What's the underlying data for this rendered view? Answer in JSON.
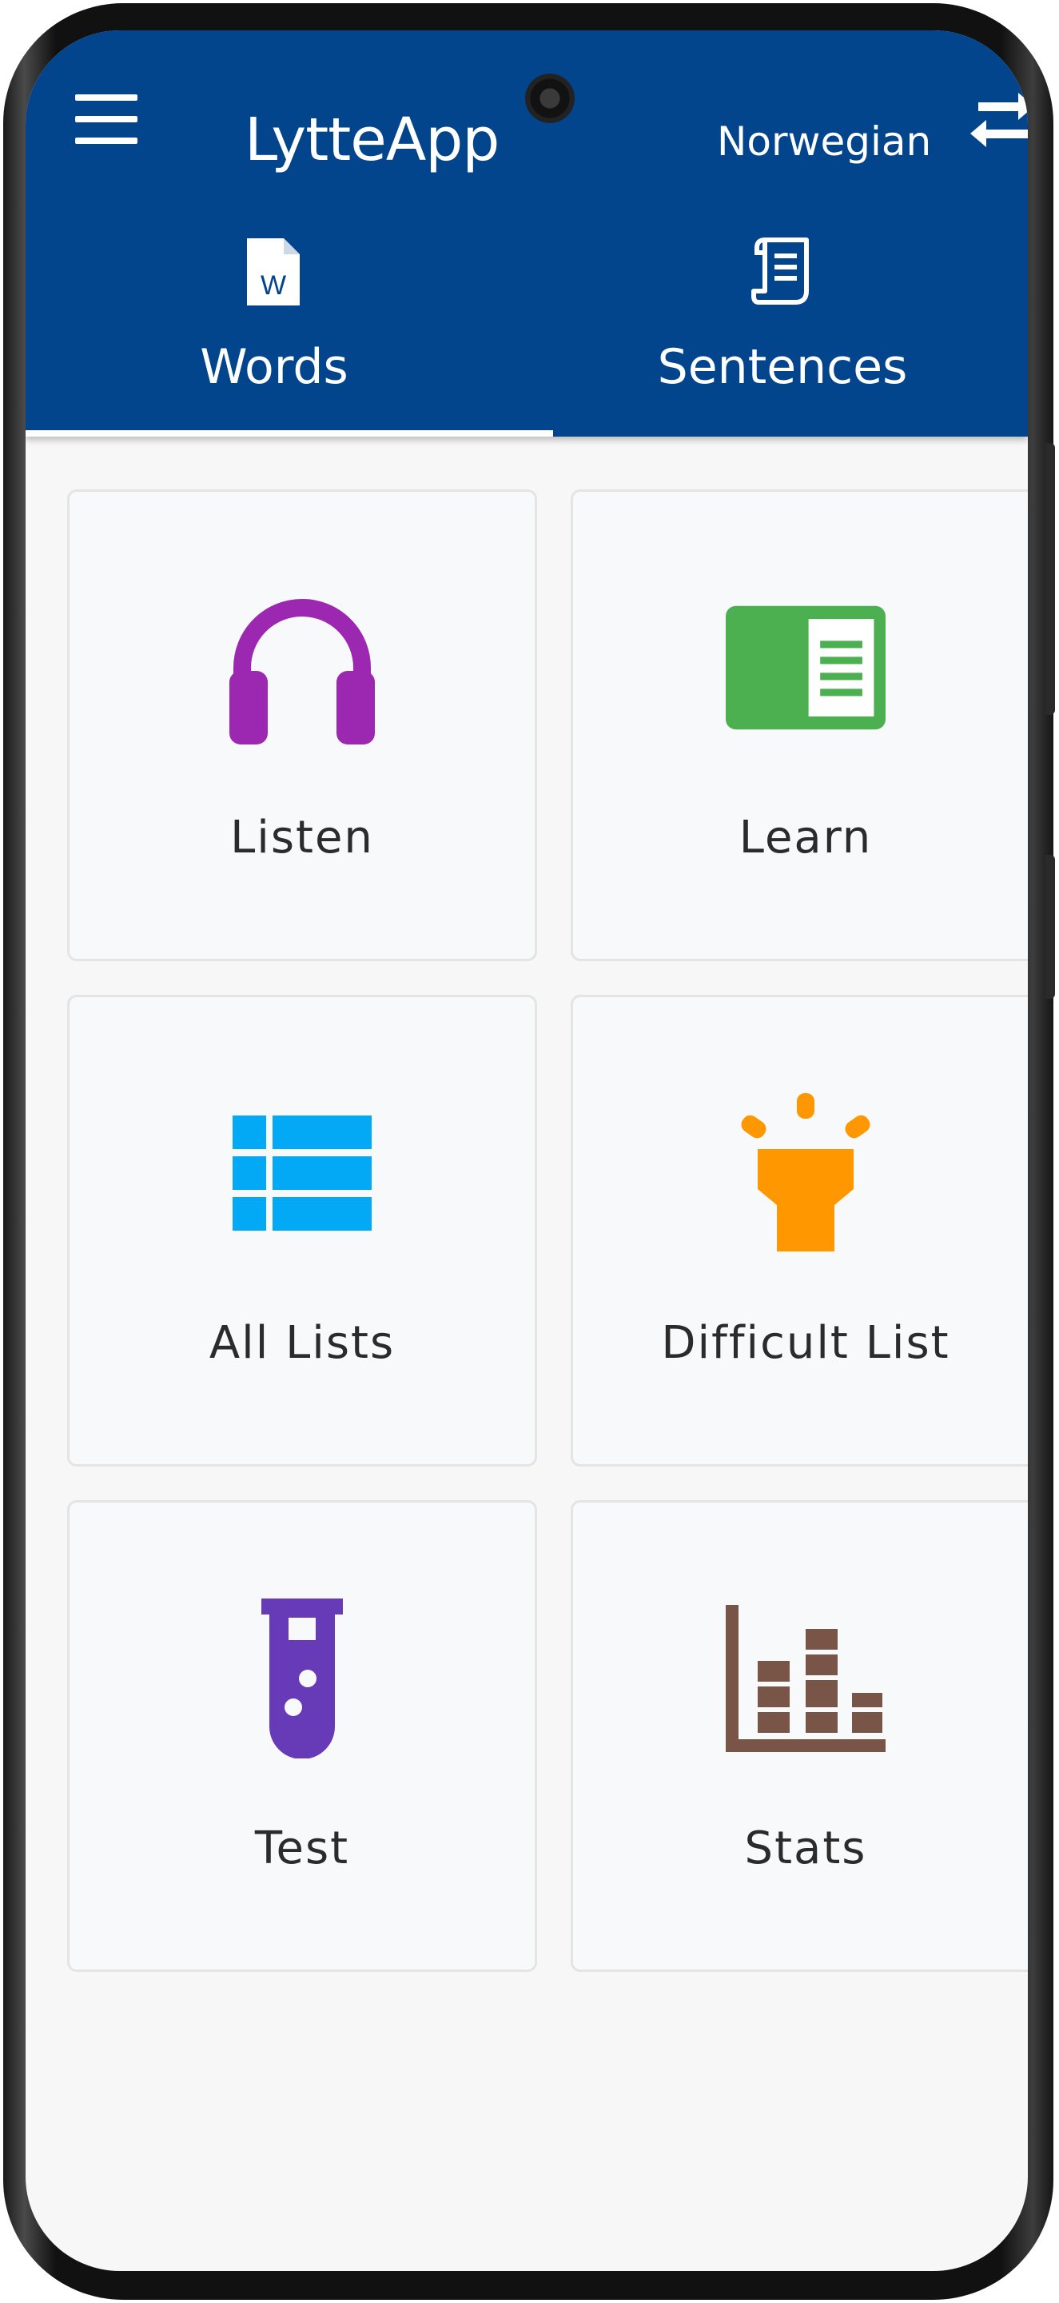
{
  "app": {
    "title": "LytteApp",
    "language": "Norwegian",
    "brand_color": "#03458c"
  },
  "tabs": [
    {
      "label": "Words",
      "icon": "word-document-icon",
      "selected": true
    },
    {
      "label": "Sentences",
      "icon": "scroll-document-icon",
      "selected": false
    }
  ],
  "menu": [
    {
      "label": "Listen",
      "icon": "headphones-icon",
      "color": "#9c27b0"
    },
    {
      "label": "Learn",
      "icon": "book-icon",
      "color": "#4caf50"
    },
    {
      "label": "All Lists",
      "icon": "list-icon",
      "color": "#03a9f4"
    },
    {
      "label": "Difficult List",
      "icon": "lamp-icon",
      "color": "#ff9800"
    },
    {
      "label": "Test",
      "icon": "test-tube-icon",
      "color": "#673ab7"
    },
    {
      "label": "Stats",
      "icon": "bar-chart-icon",
      "color": "#795548"
    }
  ]
}
